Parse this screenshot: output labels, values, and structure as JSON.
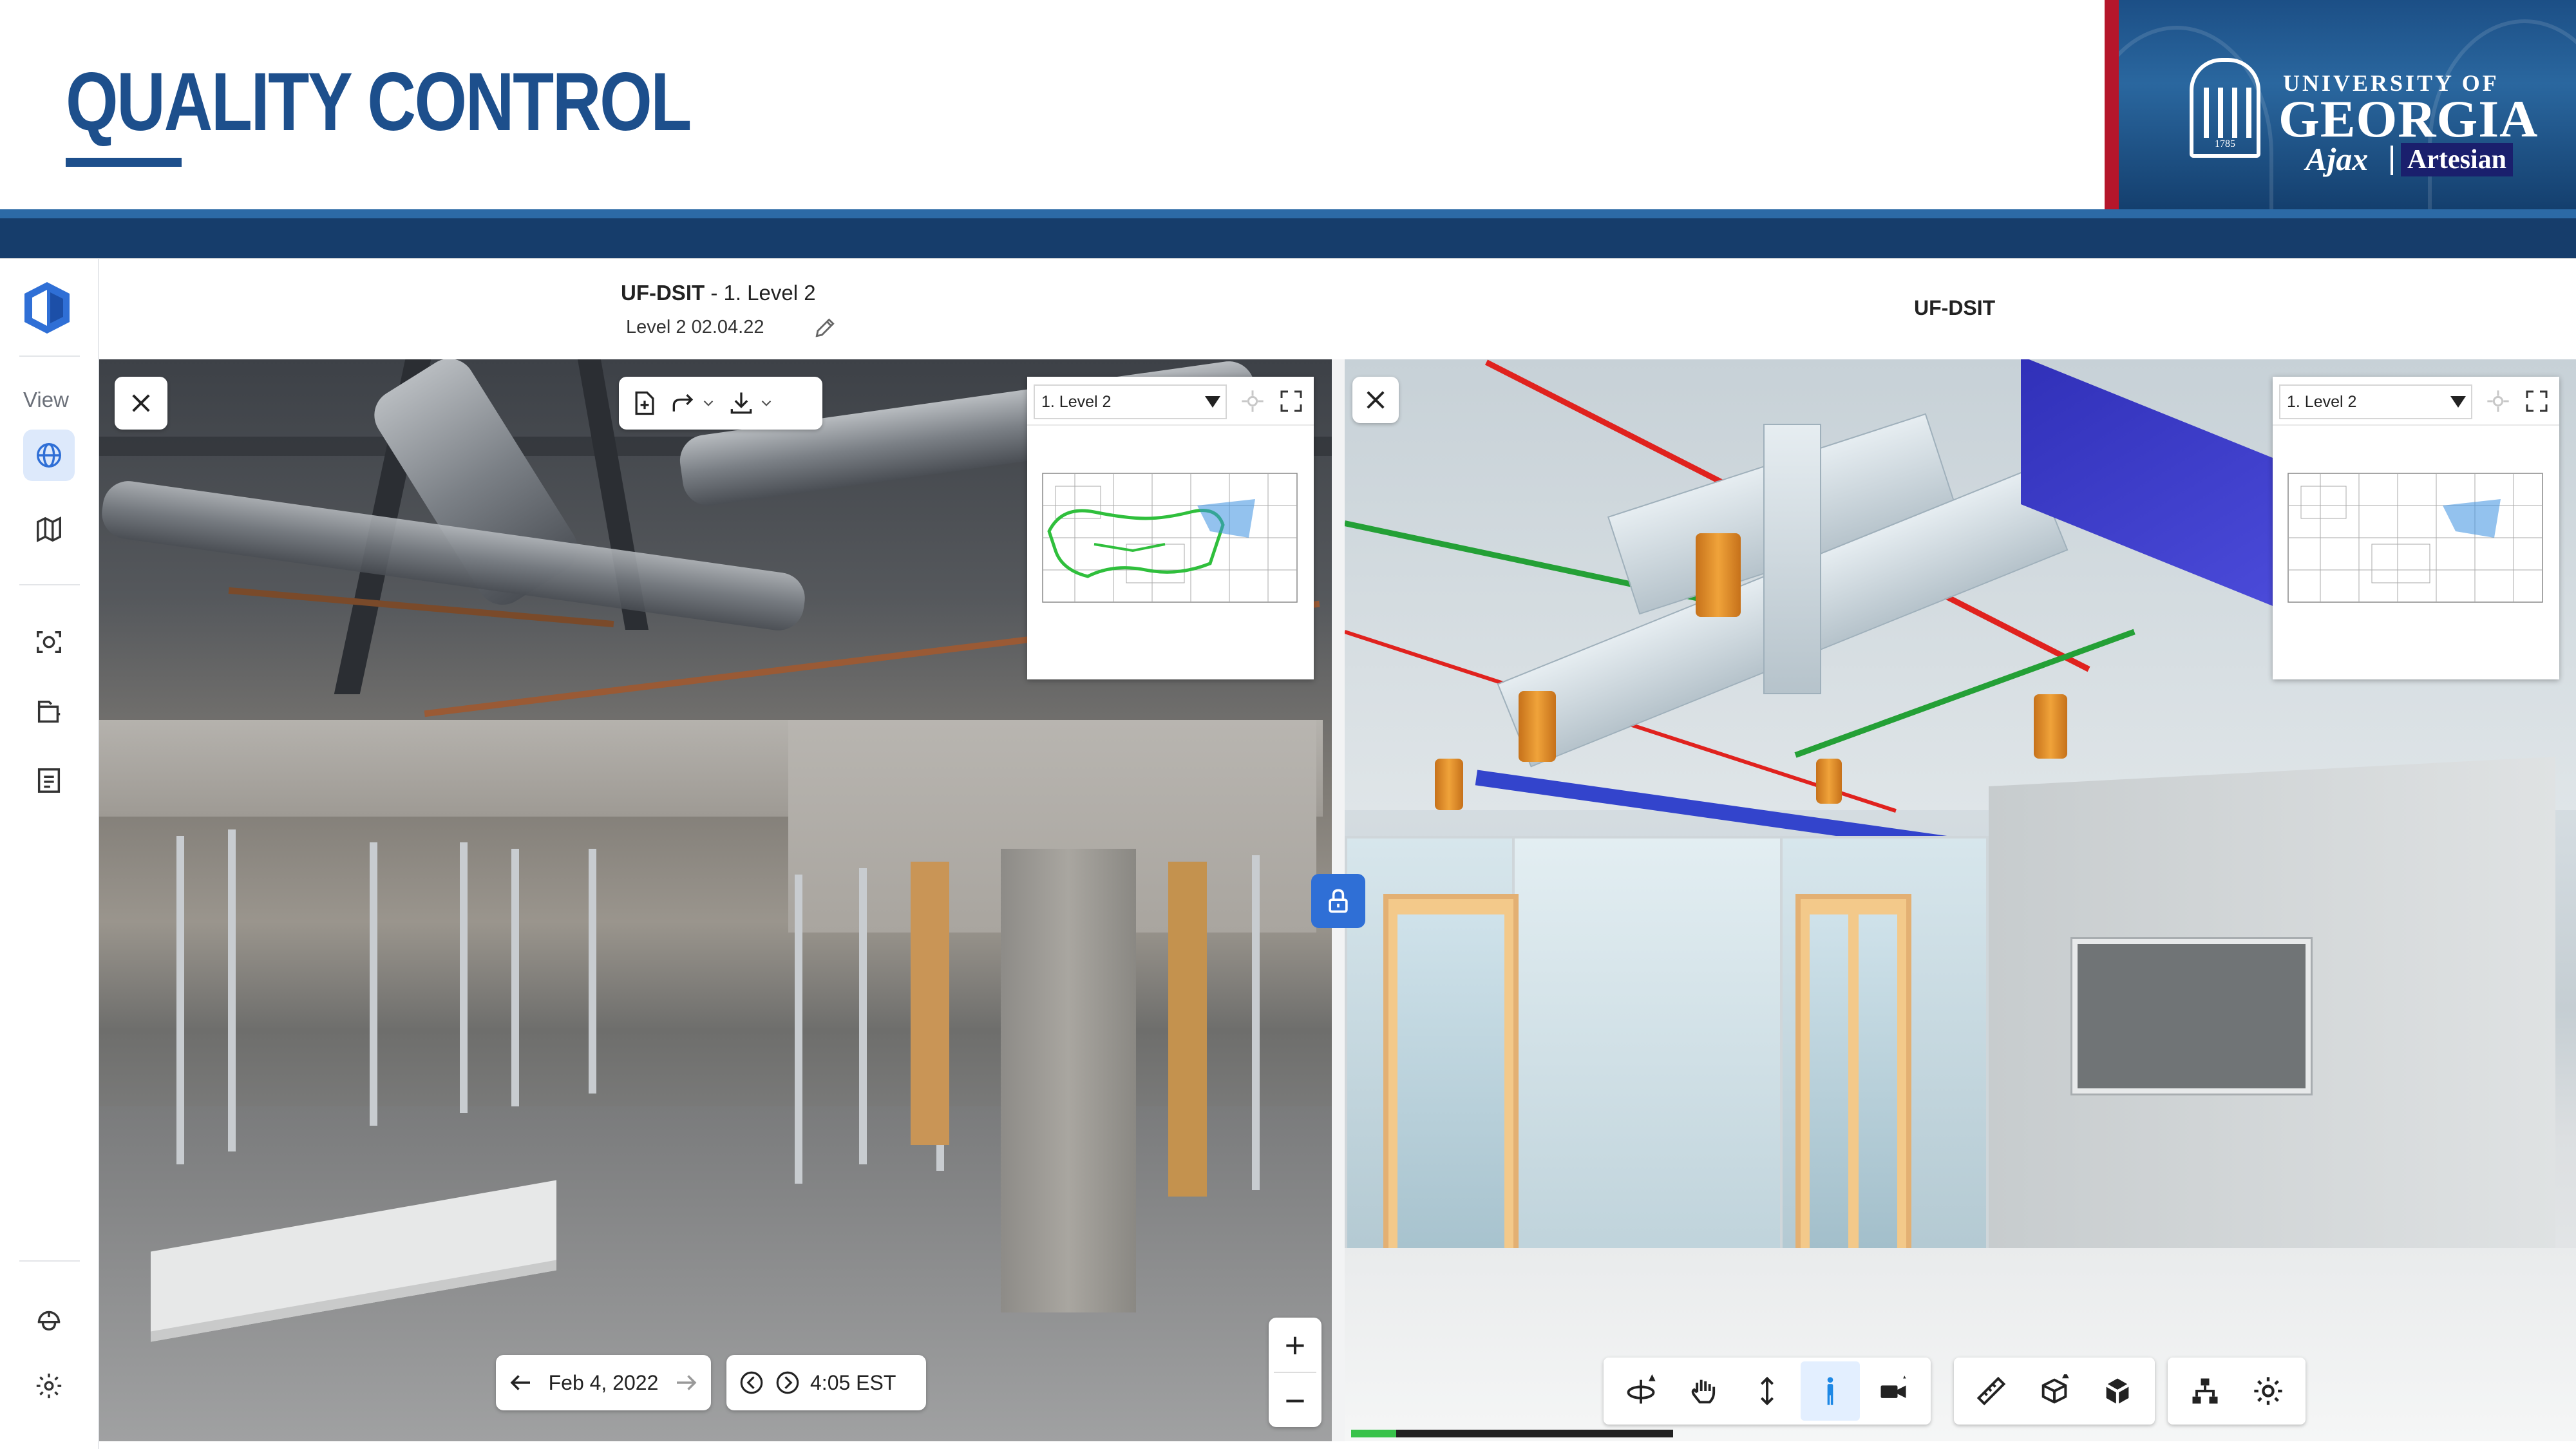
{
  "slide": {
    "title": "QUALITY CONTROL",
    "logo": {
      "university_of": "UNIVERSITY OF",
      "georgia": "GEORGIA",
      "year": "1785",
      "partner1": "Ajax",
      "partner2": "Artesian"
    }
  },
  "sidebar": {
    "section_label": "View",
    "items": [
      {
        "icon": "globe-icon",
        "active": true
      },
      {
        "icon": "map-icon",
        "active": false
      },
      {
        "icon": "capture-icon",
        "active": false
      },
      {
        "icon": "files-icon",
        "active": false
      },
      {
        "icon": "report-icon",
        "active": false
      },
      {
        "icon": "hardhat-icon",
        "active": false
      },
      {
        "icon": "gear-icon",
        "active": false
      }
    ]
  },
  "left_pane": {
    "project": "UF-DSIT",
    "separator": " - ",
    "level": "1. Level 2",
    "capture_name": "Level 2 02.04.22",
    "minimap_level": "1. Level 2",
    "date": "Feb 4, 2022",
    "time": "4:05 EST"
  },
  "right_pane": {
    "project": "UF-DSIT",
    "minimap_level": "1. Level 2"
  },
  "colors": {
    "brand_blue": "#1d4f8c",
    "accent_red": "#b5162b",
    "lock_blue": "#2f6fd6",
    "progress_green": "#38c24a"
  },
  "progress": {
    "fraction": 0.14
  }
}
